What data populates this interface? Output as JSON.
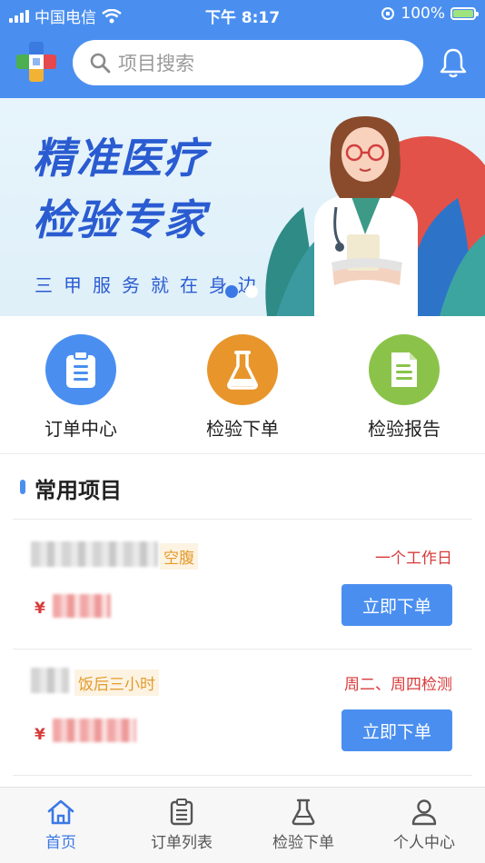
{
  "status_bar": {
    "carrier": "中国电信",
    "time": "下午 8:17",
    "battery": "100%"
  },
  "header": {
    "search_placeholder": "项目搜索",
    "logo_icon": "medical-cross-logo-icon",
    "bell_icon": "bell-icon"
  },
  "banner": {
    "title_line1": "精准医疗",
    "title_line2": "检验专家",
    "subtitle": "三甲服务就在身边",
    "slide_count": 2,
    "active_slide": 1
  },
  "quick_menu": [
    {
      "label": "订单中心",
      "icon": "clipboard-icon",
      "color": "#4a8ff0"
    },
    {
      "label": "检验下单",
      "icon": "flask-icon",
      "color": "#e8952c"
    },
    {
      "label": "检验报告",
      "icon": "report-document-icon",
      "color": "#8bc34a"
    }
  ],
  "section": {
    "title": "常用项目"
  },
  "items": [
    {
      "tag": "空腹",
      "schedule": "一个工作日",
      "currency": "¥",
      "button": "立即下单"
    },
    {
      "tag": "饭后三小时",
      "schedule": "周二、周四检测",
      "currency": "¥",
      "button": "立即下单"
    }
  ],
  "tabbar": {
    "tabs": [
      {
        "label": "首页",
        "icon": "home-icon",
        "active": true
      },
      {
        "label": "订单列表",
        "icon": "list-icon",
        "active": false
      },
      {
        "label": "检验下单",
        "icon": "flask-icon",
        "active": false
      },
      {
        "label": "个人中心",
        "icon": "user-icon",
        "active": false
      }
    ]
  },
  "colors": {
    "primary": "#4a8ff0",
    "accent_red": "#d83a3a",
    "tag_orange": "#e39b2b"
  }
}
